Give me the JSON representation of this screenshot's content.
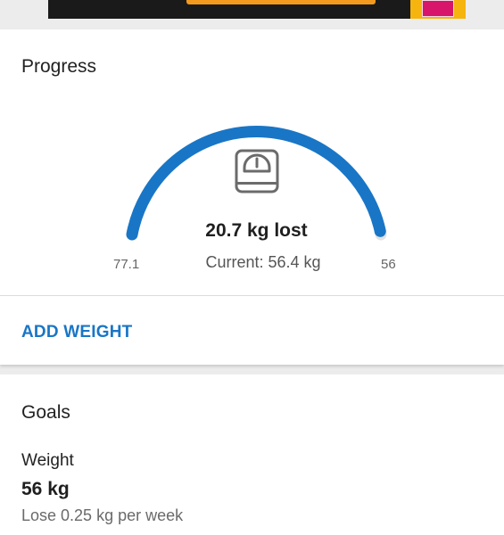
{
  "progress": {
    "title": "Progress",
    "lost_label": "20.7 kg lost",
    "current_label": "Current: 56.4 kg",
    "start_weight": "77.1",
    "goal_weight": "56",
    "progress_fraction": 0.99,
    "icon": "scale-icon",
    "accent_color": "#1976c6"
  },
  "actions": {
    "add_weight_label": "ADD WEIGHT"
  },
  "goals": {
    "title": "Goals",
    "weight_label": "Weight",
    "weight_value": "56 kg",
    "rate_label": "Lose 0.25 kg per week"
  }
}
